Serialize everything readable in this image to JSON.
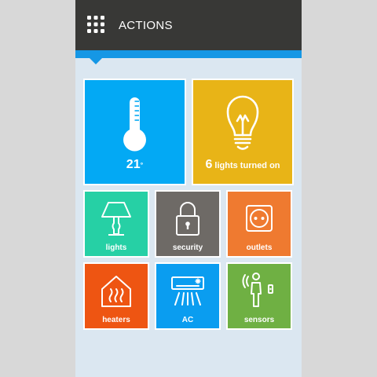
{
  "header": {
    "title": "ACTIONS"
  },
  "tiles": {
    "temperature": {
      "value": "21",
      "unit": "°"
    },
    "lights_on": {
      "count": "6",
      "text": "lights turned on"
    },
    "lights": {
      "label": "lights"
    },
    "security": {
      "label": "security"
    },
    "outlets": {
      "label": "outlets"
    },
    "heaters": {
      "label": "heaters"
    },
    "ac": {
      "label": "AC"
    },
    "sensors": {
      "label": "sensors"
    }
  },
  "icons": {
    "menu": "grid-menu-icon",
    "temperature": "thermometer-icon",
    "lights_on": "lightbulb-icon",
    "lights": "table-lamp-icon",
    "security": "padlock-icon",
    "outlets": "power-outlet-icon",
    "heaters": "heater-icon",
    "ac": "air-conditioner-icon",
    "sensors": "motion-sensor-icon"
  },
  "colors": {
    "header_bg": "#383836",
    "accent_bar": "#1597e5",
    "temperature": "#03a9f4",
    "lights_on": "#e8b417",
    "lights": "#26d0a5",
    "security": "#6e6a66",
    "outlets": "#ef7a30",
    "heaters": "#ee5512",
    "ac": "#0a9df0",
    "sensors": "#6fb043"
  }
}
